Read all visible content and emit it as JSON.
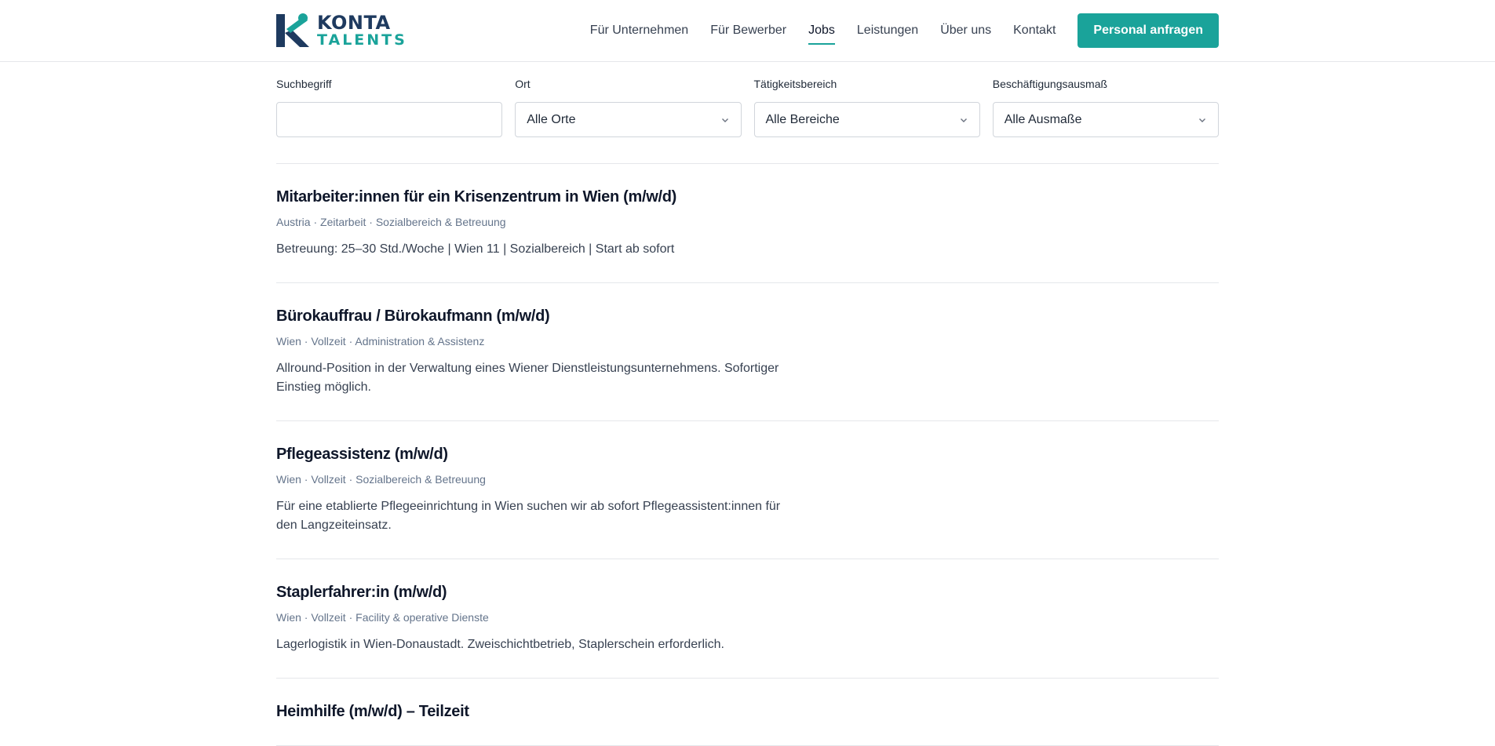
{
  "brand": {
    "top": "KONTA",
    "bottom": "TALENTS",
    "colors": {
      "navy": "#1e3a5f",
      "teal": "#1aa39a"
    }
  },
  "nav": {
    "items": [
      "Für Unternehmen",
      "Für Bewerber",
      "Jobs",
      "Leistungen",
      "Über uns",
      "Kontakt"
    ],
    "active": "Jobs",
    "cta": "Personal anfragen"
  },
  "filters": {
    "search_label": "Suchbegriff",
    "search_value": "",
    "location_label": "Ort",
    "location_value": "Alle Orte",
    "area_label": "Tätigkeitsbereich",
    "area_value": "Alle Bereiche",
    "extent_label": "Beschäftigungsausmaß",
    "extent_value": "Alle Ausmaße"
  },
  "jobs": [
    {
      "title": "Mitarbeiter:innen für ein Krisenzentrum in Wien (m/w/d)",
      "meta": "Austria · Zeitarbeit · Sozialbereich & Betreuung",
      "desc": "Betreuung: 25–30 Std./Woche | Wien 11 | Sozialbereich | Start ab sofort"
    },
    {
      "title": "Bürokauffrau / Bürokaufmann (m/w/d)",
      "meta": "Wien · Vollzeit · Administration & Assistenz",
      "desc": "Allround-Position in der Verwaltung eines Wiener Dienstleistungsunternehmens. Sofortiger Einstieg möglich."
    },
    {
      "title": "Pflegeassistenz (m/w/d)",
      "meta": "Wien · Vollzeit · Sozialbereich & Betreuung",
      "desc": "Für eine etablierte Pflegeeinrichtung in Wien suchen wir ab sofort Pflegeassistent:innen für den Langzeiteinsatz."
    },
    {
      "title": "Staplerfahrer:in (m/w/d)",
      "meta": "Wien · Vollzeit · Facility & operative Dienste",
      "desc": "Lagerlogistik in Wien-Donaustadt. Zweischichtbetrieb, Staplerschein erforderlich."
    },
    {
      "title": "Heimhilfe (m/w/d) – Teilzeit",
      "meta": "",
      "desc": ""
    }
  ]
}
